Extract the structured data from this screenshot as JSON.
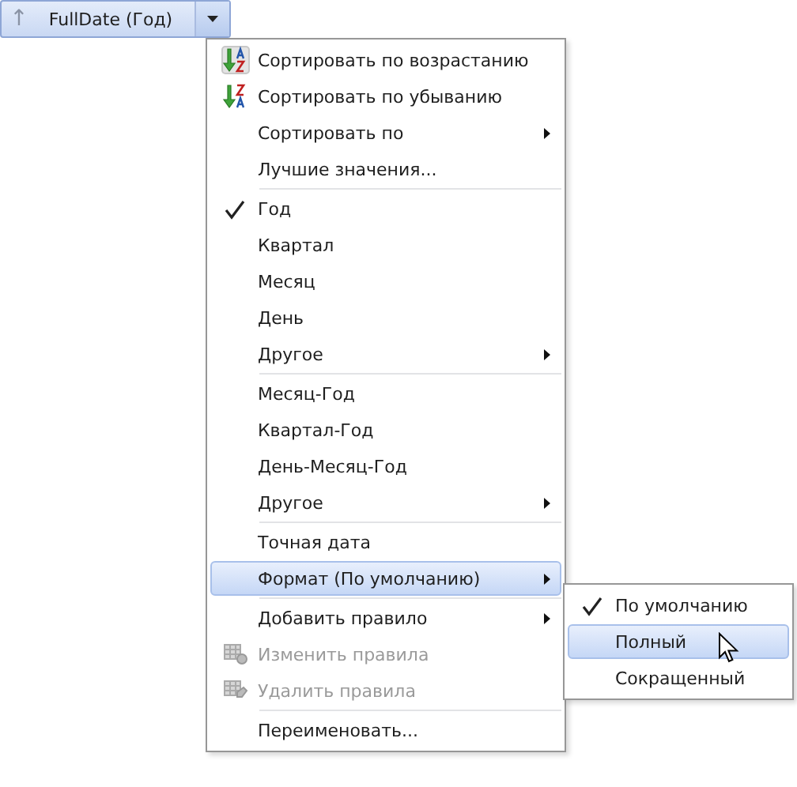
{
  "field_header": {
    "label": "FullDate (Год)",
    "sort_arrow": "↑",
    "expanded": true
  },
  "menu": {
    "sections": [
      {
        "items": [
          {
            "label": "Сортировать по возрастанию",
            "kind": "sort-asc",
            "checked": false,
            "selected": false,
            "disabled": false,
            "submenu": false
          },
          {
            "label": "Сортировать по убыванию",
            "kind": "sort-desc",
            "checked": false,
            "selected": false,
            "disabled": false,
            "submenu": false
          },
          {
            "label": "Сортировать по",
            "checked": false,
            "selected": false,
            "disabled": false,
            "submenu": true
          },
          {
            "label": "Лучшие значения...",
            "checked": false,
            "selected": false,
            "disabled": false,
            "submenu": false
          }
        ]
      },
      {
        "items": [
          {
            "label": "Год",
            "checked": true,
            "selected": false,
            "disabled": false,
            "submenu": false
          },
          {
            "label": "Квартал",
            "checked": false,
            "selected": false,
            "disabled": false,
            "submenu": false
          },
          {
            "label": "Месяц",
            "checked": false,
            "selected": false,
            "disabled": false,
            "submenu": false
          },
          {
            "label": "День",
            "checked": false,
            "selected": false,
            "disabled": false,
            "submenu": false
          },
          {
            "label": "Другое",
            "checked": false,
            "selected": false,
            "disabled": false,
            "submenu": true
          }
        ]
      },
      {
        "items": [
          {
            "label": "Месяц-Год",
            "checked": false,
            "selected": false,
            "disabled": false,
            "submenu": false
          },
          {
            "label": "Квартал-Год",
            "checked": false,
            "selected": false,
            "disabled": false,
            "submenu": false
          },
          {
            "label": "День-Месяц-Год",
            "checked": false,
            "selected": false,
            "disabled": false,
            "submenu": false
          },
          {
            "label": "Другое",
            "checked": false,
            "selected": false,
            "disabled": false,
            "submenu": true
          }
        ]
      },
      {
        "items": [
          {
            "label": "Точная дата",
            "checked": false,
            "selected": false,
            "disabled": false,
            "submenu": false
          },
          {
            "label": "Формат (По умолчанию)",
            "checked": false,
            "selected": true,
            "disabled": false,
            "submenu": true
          }
        ]
      },
      {
        "items": [
          {
            "label": "Добавить правило",
            "checked": false,
            "selected": false,
            "disabled": false,
            "submenu": true
          },
          {
            "label": "Изменить правила",
            "kind": "edit-rules",
            "checked": false,
            "selected": false,
            "disabled": true,
            "submenu": false
          },
          {
            "label": "Удалить правила",
            "kind": "delete-rules",
            "checked": false,
            "selected": false,
            "disabled": true,
            "submenu": false
          }
        ]
      },
      {
        "items": [
          {
            "label": "Переименовать...",
            "checked": false,
            "selected": false,
            "disabled": false,
            "submenu": false
          }
        ]
      }
    ]
  },
  "submenu": {
    "items": [
      {
        "label": "По умолчанию",
        "checked": true,
        "selected": false
      },
      {
        "label": "Полный",
        "checked": false,
        "selected": true
      },
      {
        "label": "Сокращенный",
        "checked": false,
        "selected": false
      }
    ]
  }
}
